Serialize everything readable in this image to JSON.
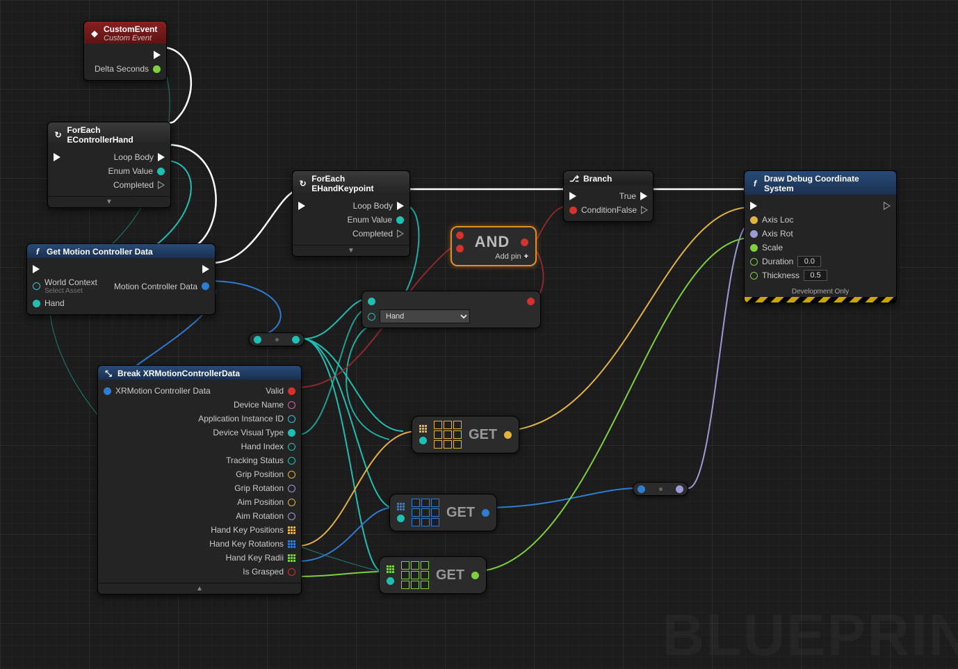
{
  "watermark": "BLUEPRIN",
  "nodes": {
    "customEvent": {
      "title": "CustomEvent",
      "subtitle": "Custom Event",
      "outputs": {
        "exec": "",
        "delta": "Delta Seconds"
      }
    },
    "forEachHand": {
      "title": "ForEach EControllerHand",
      "loopBody": "Loop Body",
      "enumValue": "Enum Value",
      "completed": "Completed"
    },
    "getMotion": {
      "title": "Get Motion Controller Data",
      "worldContext": "World Context",
      "selectAsset": "Select Asset",
      "hand": "Hand",
      "output": "Motion Controller Data"
    },
    "forEachKeypoint": {
      "title": "ForEach EHandKeypoint",
      "loopBody": "Loop Body",
      "enumValue": "Enum Value",
      "completed": "Completed"
    },
    "branch": {
      "title": "Branch",
      "condition": "Condition",
      "true": "True",
      "false": "False"
    },
    "and": {
      "title": "AND",
      "addPin": "Add pin"
    },
    "eqEnum": {
      "select": "Hand"
    },
    "break": {
      "title": "Break XRMotionControllerData",
      "input": "XRMotion Controller Data",
      "outputs": [
        "Valid",
        "Device Name",
        "Application Instance ID",
        "Device Visual Type",
        "Hand Index",
        "Tracking Status",
        "Grip Position",
        "Grip Rotation",
        "Aim Position",
        "Aim Rotation",
        "Hand Key Positions",
        "Hand Key Rotations",
        "Hand Key Radii",
        "Is Grasped"
      ]
    },
    "get": "GET",
    "draw": {
      "title": "Draw Debug Coordinate System",
      "axisLoc": "Axis Loc",
      "axisRot": "Axis Rot",
      "scale": "Scale",
      "duration": "Duration",
      "durationVal": "0.0",
      "thickness": "Thickness",
      "thicknessVal": "0.5",
      "devOnly": "Development Only"
    }
  }
}
